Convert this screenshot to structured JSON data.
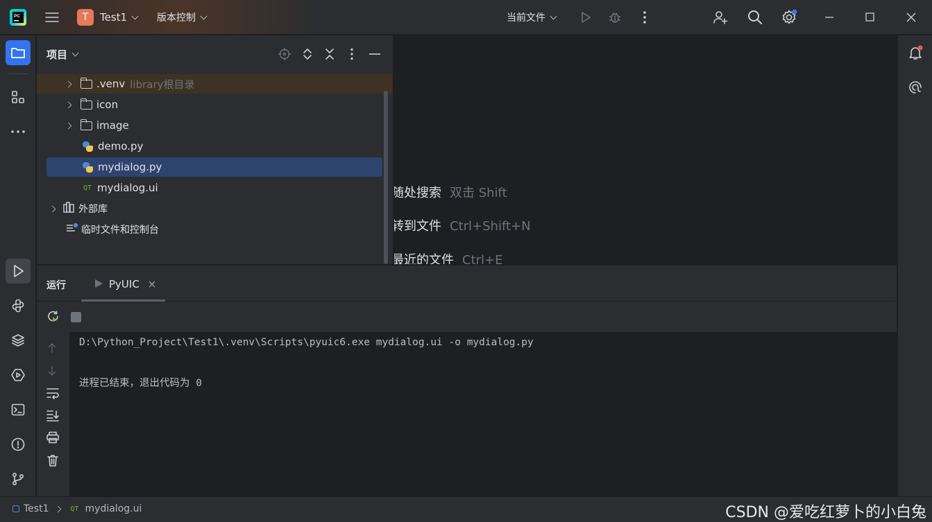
{
  "titlebar": {
    "project_initial": "T",
    "project_name": "Test1",
    "vcs_label": "版本控制",
    "run_config": "当前文件"
  },
  "project_panel": {
    "title": "项目",
    "items": [
      {
        "label": ".venv",
        "sublabel": "library根目录",
        "kind": "folder"
      },
      {
        "label": "icon",
        "kind": "folder"
      },
      {
        "label": "image",
        "kind": "folder"
      },
      {
        "label": "demo.py",
        "kind": "python"
      },
      {
        "label": "mydialog.py",
        "kind": "python",
        "selected": true
      },
      {
        "label": "mydialog.ui",
        "kind": "qt",
        "badge": "QT"
      },
      {
        "label": "外部库",
        "kind": "library"
      },
      {
        "label": "临时文件和控制台",
        "kind": "scratch"
      }
    ]
  },
  "editor_hints": [
    {
      "label": "随处搜索",
      "shortcut": "双击 Shift"
    },
    {
      "label": "转到文件",
      "shortcut": "Ctrl+Shift+N"
    },
    {
      "label": "最近的文件",
      "shortcut": "Ctrl+E"
    }
  ],
  "run_panel": {
    "title": "运行",
    "tab_label": "PyUIC",
    "console_lines": [
      "D:\\Python_Project\\Test1\\.venv\\Scripts\\pyuic6.exe mydialog.ui -o mydialog.py",
      "",
      "进程已结束，退出代码为 0"
    ]
  },
  "statusbar": {
    "crumb_project": "Test1",
    "crumb_file_badge": "QT",
    "crumb_file": "mydialog.ui",
    "watermark": "CSDN @爱吃红萝卜的小白兔"
  },
  "colors": {
    "accent": "#3574f0",
    "selection": "#2e436e",
    "venv_highlight": "#3d3223",
    "project_badge": "#e8785a",
    "notification_dot": "#e55765"
  }
}
